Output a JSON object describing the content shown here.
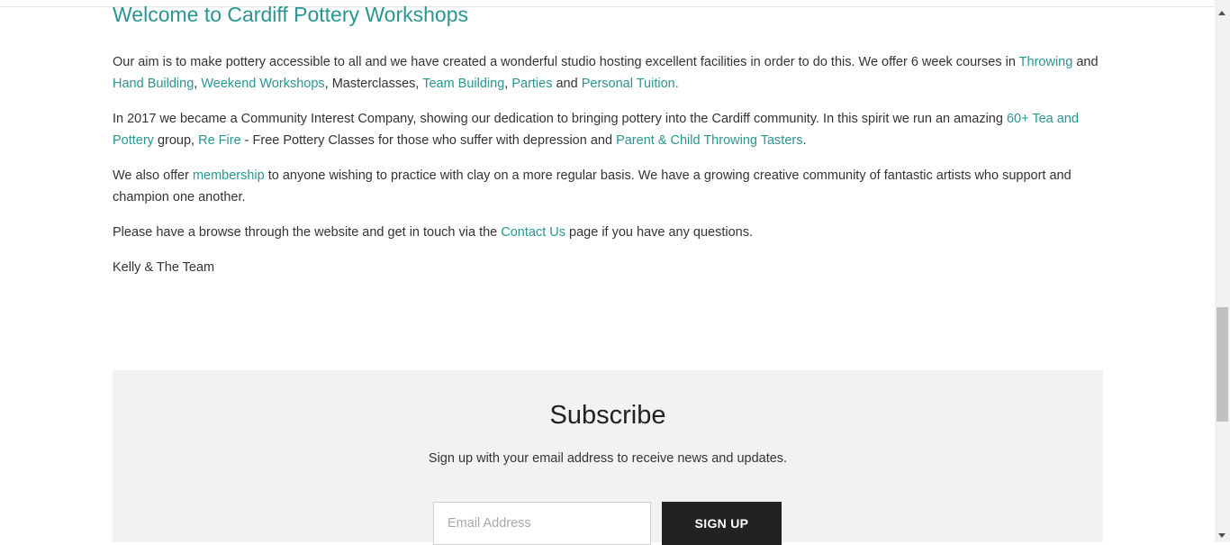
{
  "heading": "Welcome to Cardiff Pottery Workshops",
  "p1": {
    "t1": "Our aim is to make pottery accessible to all and we have created a wonderful studio hosting excellent facilities in order to do this. We offer 6 week courses in ",
    "link_throwing": "Throwing",
    "t2": " and ",
    "link_hand_building": "Hand Building",
    "t3": ", ",
    "link_weekend": "Weekend Workshops",
    "t4": ", Masterclasses, ",
    "link_team": "Team Building",
    "t5": ", ",
    "link_parties": "Parties",
    "t6": " and ",
    "link_tuition": "Personal Tuition."
  },
  "p2": {
    "t1": "In 2017 we became a Community Interest Company, showing our dedication to bringing pottery into the Cardiff community. In this spirit we run an amazing ",
    "link_tea": "60+ Tea and Pottery",
    "t2": " group, ",
    "link_refire": "Re Fire",
    "t3": " - Free Pottery Classes for those who suffer with depression and ",
    "link_parent": "Parent & Child Throwing Tasters",
    "t4": "."
  },
  "p3": {
    "t1": "We also offer ",
    "link_membership": "membership",
    "t2": " to anyone wishing to practice with clay on a more regular basis. We have a growing creative community of fantastic artists who support and champion one another."
  },
  "p4": {
    "t1": "Please have a browse through the website and get in touch via the ",
    "link_contact": "Contact Us",
    "t2": " page if you have any questions."
  },
  "signoff": "Kelly & The Team",
  "subscribe": {
    "title": "Subscribe",
    "description": "Sign up with your email address to receive news and updates.",
    "email_placeholder": "Email Address",
    "button_label": "SIGN UP"
  },
  "colors": {
    "link": "#2a9591",
    "text": "#333333",
    "panel": "#f2f2f2",
    "button": "#222222"
  }
}
